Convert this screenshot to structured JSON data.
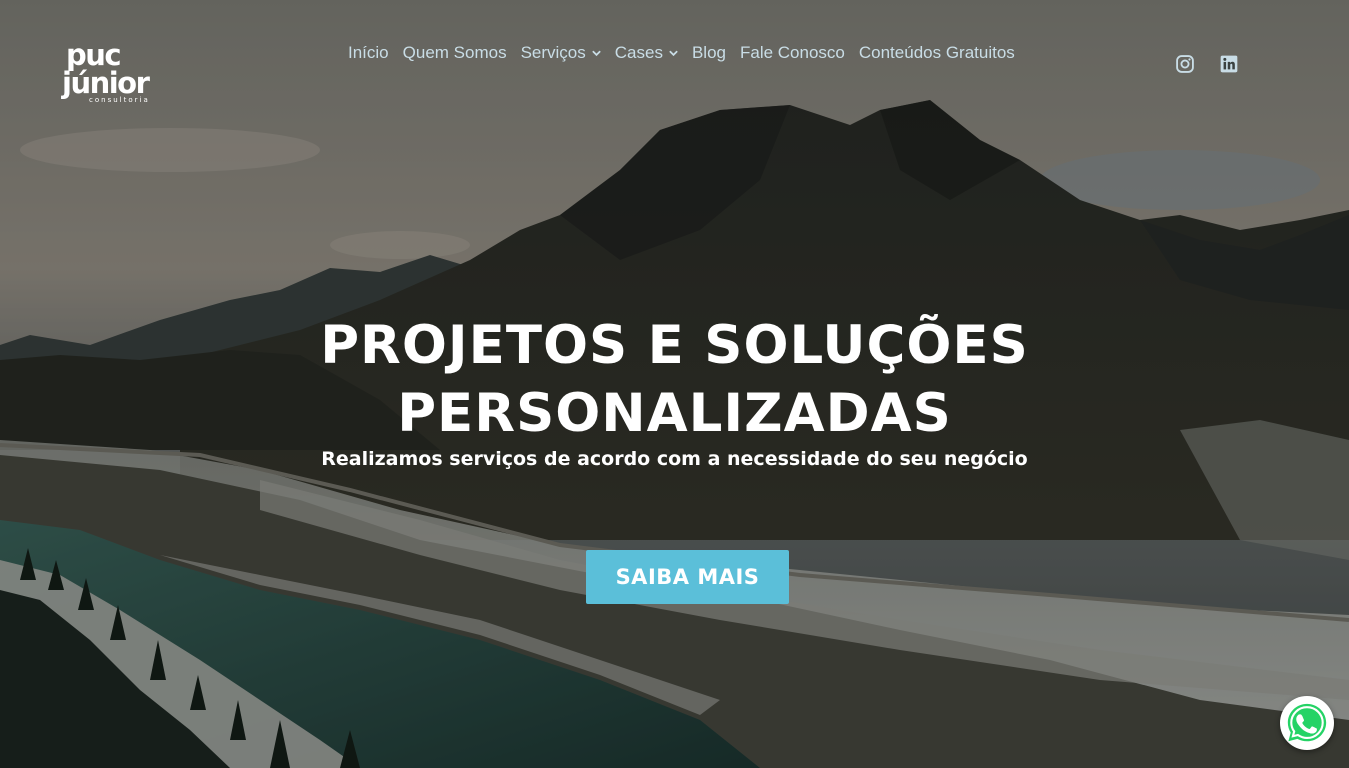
{
  "logo": {
    "line1": "puc",
    "line2": "júnior",
    "line3": "consultoria"
  },
  "nav": {
    "items": [
      {
        "label": "Início",
        "has_dropdown": false
      },
      {
        "label": "Quem Somos",
        "has_dropdown": false
      },
      {
        "label": "Serviços",
        "has_dropdown": true
      },
      {
        "label": "Cases",
        "has_dropdown": true
      },
      {
        "label": "Blog",
        "has_dropdown": false
      },
      {
        "label": "Fale Conosco",
        "has_dropdown": false
      },
      {
        "label": "Conteúdos Gratuitos",
        "has_dropdown": false
      }
    ]
  },
  "social": {
    "icons": [
      "instagram-icon",
      "linkedin-icon"
    ]
  },
  "hero": {
    "headline_line1": "PROJETOS E SOLUÇÕES",
    "headline_line2": "PERSONALIZADAS",
    "subheadline": "Realizamos serviços de acordo com a necessidade do seu negócio",
    "cta_label": "SAIBA MAIS",
    "background": "mountain-river-landscape"
  },
  "floating": {
    "icon": "whatsapp-icon"
  },
  "colors": {
    "accent": "#5bbfd9",
    "nav_text": "#c9dde6",
    "whatsapp_green": "#25d366"
  }
}
